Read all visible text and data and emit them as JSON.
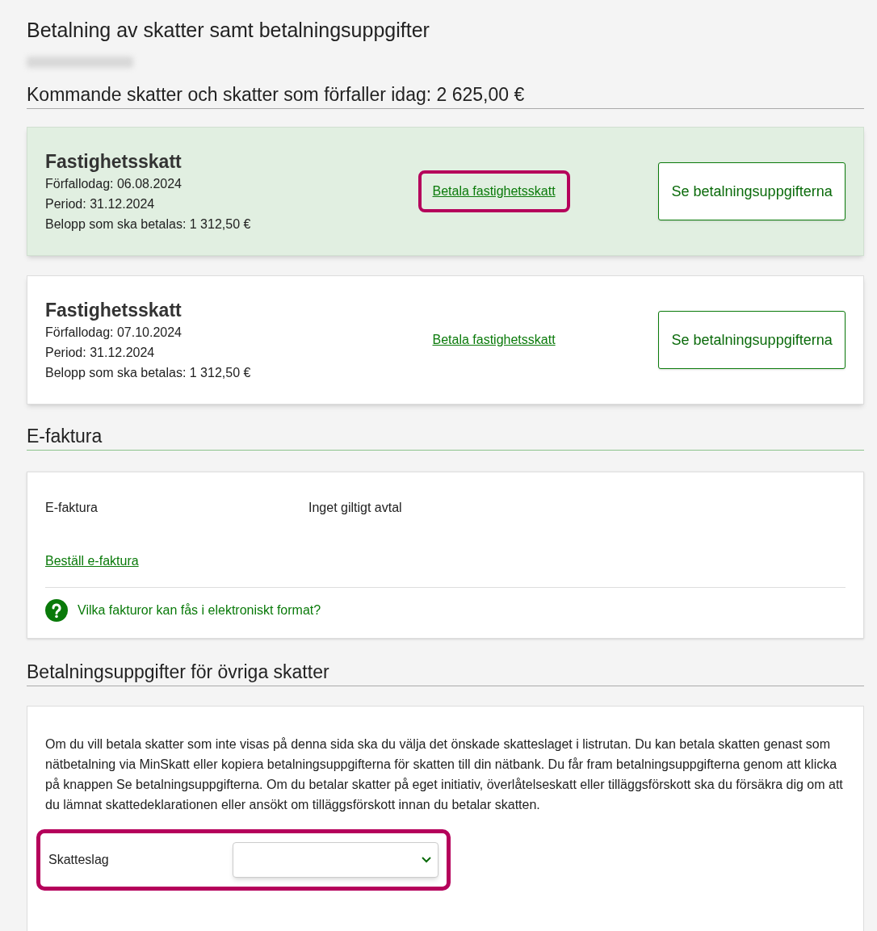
{
  "page_title": "Betalning av skatter samt betalningsuppgifter",
  "upcoming": {
    "heading": "Kommande skatter och skatter som förfaller idag: 2 625,00 €",
    "taxes": [
      {
        "title": "Fastighetsskatt",
        "due": "Förfallodag: 06.08.2024",
        "period": "Period: 31.12.2024",
        "amount": "Belopp som ska betalas: 1 312,50 €",
        "pay_link": "Betala fastighetsskatt",
        "details_button": "Se betalningsuppgifterna",
        "selected": true,
        "link_annotated": true
      },
      {
        "title": "Fastighetsskatt",
        "due": "Förfallodag: 07.10.2024",
        "period": "Period: 31.12.2024",
        "amount": "Belopp som ska betalas: 1 312,50 €",
        "pay_link": "Betala fastighetsskatt",
        "details_button": "Se betalningsuppgifterna",
        "selected": false,
        "link_annotated": false
      }
    ]
  },
  "efaktura": {
    "heading": "E-faktura",
    "label": "E-faktura",
    "value": "Inget giltigt avtal",
    "order_link": "Beställ e-faktura",
    "help_link": "Vilka fakturor kan fås i elektroniskt format?"
  },
  "other_taxes": {
    "heading": "Betalningsuppgifter för övriga skatter",
    "intro": "Om du vill betala skatter som inte visas på denna sida ska du välja det önskade skatteslaget i listrutan. Du kan betala skatten genast som nätbetalning via MinSkatt eller kopiera betalningsuppgifterna för skatten till din nätbank. Du får fram betalningsuppgifterna genom att klicka på knappen Se betalningsuppgifterna. Om du betalar skatter på eget initiativ, överlåtelseskatt eller tilläggsförskott ska du försäkra dig om att du lämnat skattedeklarationen eller ansökt om tilläggsförskott innan du betalar skatten.",
    "select_label": "Skatteslag",
    "select_annotated": true
  }
}
